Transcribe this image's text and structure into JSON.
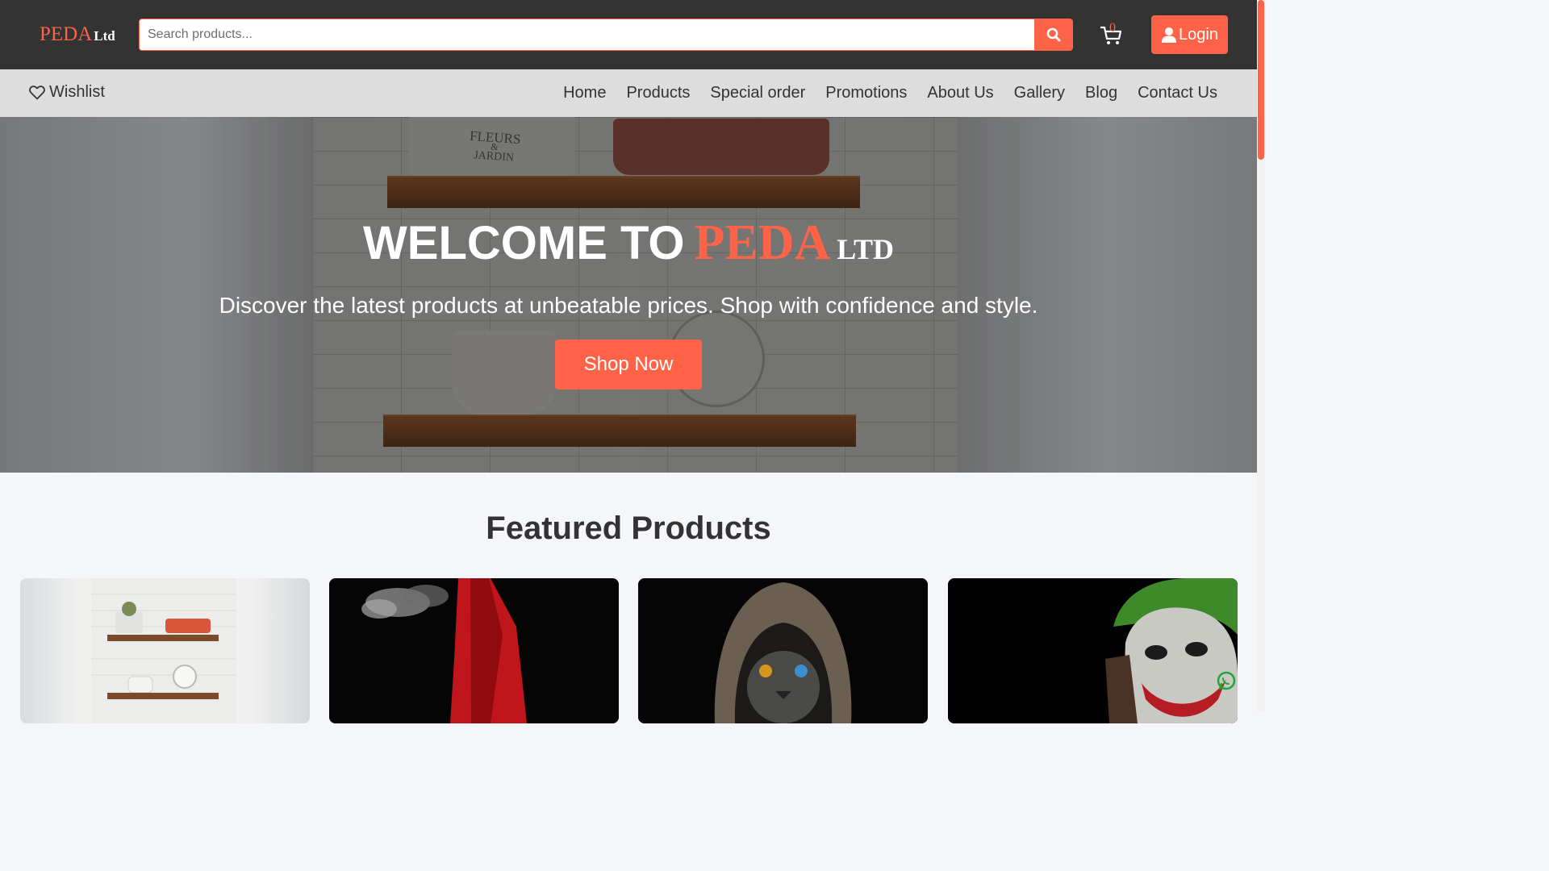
{
  "header": {
    "logo_main": "PEDA",
    "logo_suffix": "Ltd",
    "search_placeholder": "Search products...",
    "search_icon": "search-icon",
    "cart_icon": "cart-icon",
    "cart_count": "0",
    "login_label": "Login",
    "login_icon": "user-icon"
  },
  "nav": {
    "wishlist_label": "Wishlist",
    "wishlist_icon": "heart-icon",
    "links": [
      "Home",
      "Products",
      "Special order",
      "Promotions",
      "About Us",
      "Gallery",
      "Blog",
      "Contact Us"
    ]
  },
  "hero": {
    "title_prefix": "WELCOME TO",
    "title_brand": "PEDA",
    "title_suffix": "LTD",
    "subtitle": "Discover the latest products at unbeatable prices. Shop with confidence and style.",
    "cta_label": "Shop Now",
    "image_text": [
      "FLEURS",
      "&",
      "JARDIN"
    ]
  },
  "featured": {
    "title": "Featured Products",
    "products": [
      {
        "image": "kitchen-shelves-image"
      },
      {
        "image": "red-coat-smoke-image"
      },
      {
        "image": "hooded-cat-image"
      },
      {
        "image": "joker-image"
      }
    ]
  },
  "colors": {
    "accent": "#ff6347",
    "header_bg": "#333333",
    "nav_bg": "#dddddd",
    "page_bg": "#f4f6fa"
  },
  "floating": {
    "whatsapp_icon": "whatsapp-icon"
  }
}
